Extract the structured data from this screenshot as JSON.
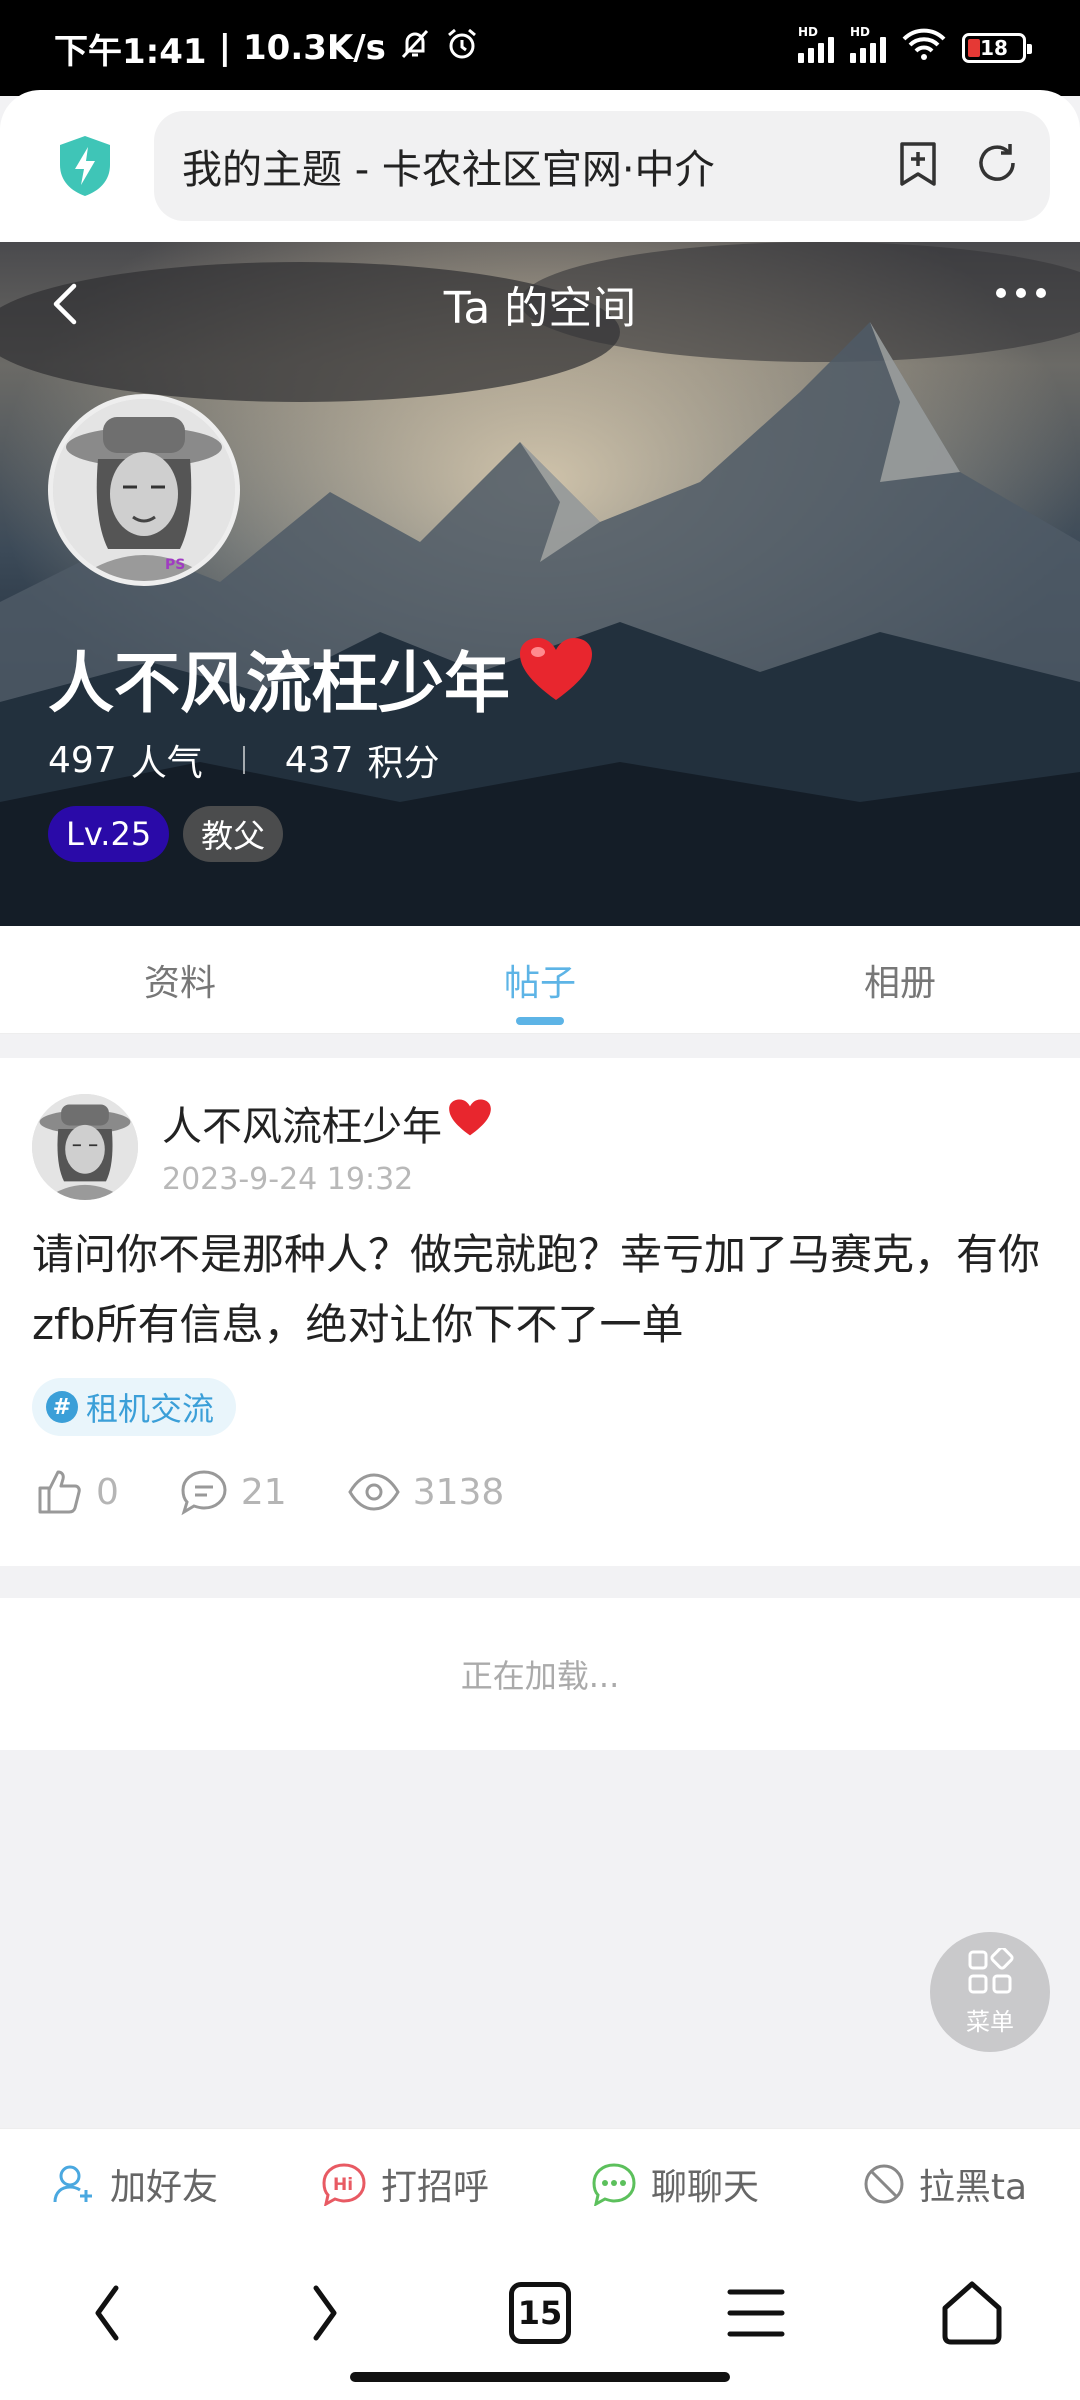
{
  "status_bar": {
    "time": "下午1:41",
    "net_speed": "10.3K/s",
    "battery": "18",
    "sim1_label": "HD",
    "sim2_label": "HD"
  },
  "browser": {
    "url_title": "我的主题 - 卡农社区官网·中介",
    "tab_count": "15"
  },
  "profile": {
    "page_title": "Ta 的空间",
    "username": "人不风流枉少年",
    "popularity_value": "497",
    "popularity_label": "人气",
    "points_value": "437",
    "points_label": "积分",
    "level": "Lv.25",
    "title_badge": "教父",
    "avatar_watermark": "PS"
  },
  "tabs": [
    {
      "label": "资料",
      "active": false
    },
    {
      "label": "帖子",
      "active": true
    },
    {
      "label": "相册",
      "active": false
    }
  ],
  "post": {
    "author": "人不风流枉少年",
    "time": "2023-9-24 19:32",
    "body": "请问你不是那种人？做完就跑？幸亏加了马赛克，有你zfb所有信息，绝对让你下不了一单",
    "tag": "租机交流",
    "likes": "0",
    "comments": "21",
    "views": "3138"
  },
  "loading_text": "正在加载...",
  "fab_label": "菜单",
  "action_bar": {
    "add_friend": "加好友",
    "greet": "打招呼",
    "chat": "聊聊天",
    "block": "拉黑ta"
  },
  "colors": {
    "accent": "#5db4e6",
    "level_badge": "#2a0aa8",
    "tag_text": "#3b9fd8",
    "heart": "#e8262e"
  }
}
